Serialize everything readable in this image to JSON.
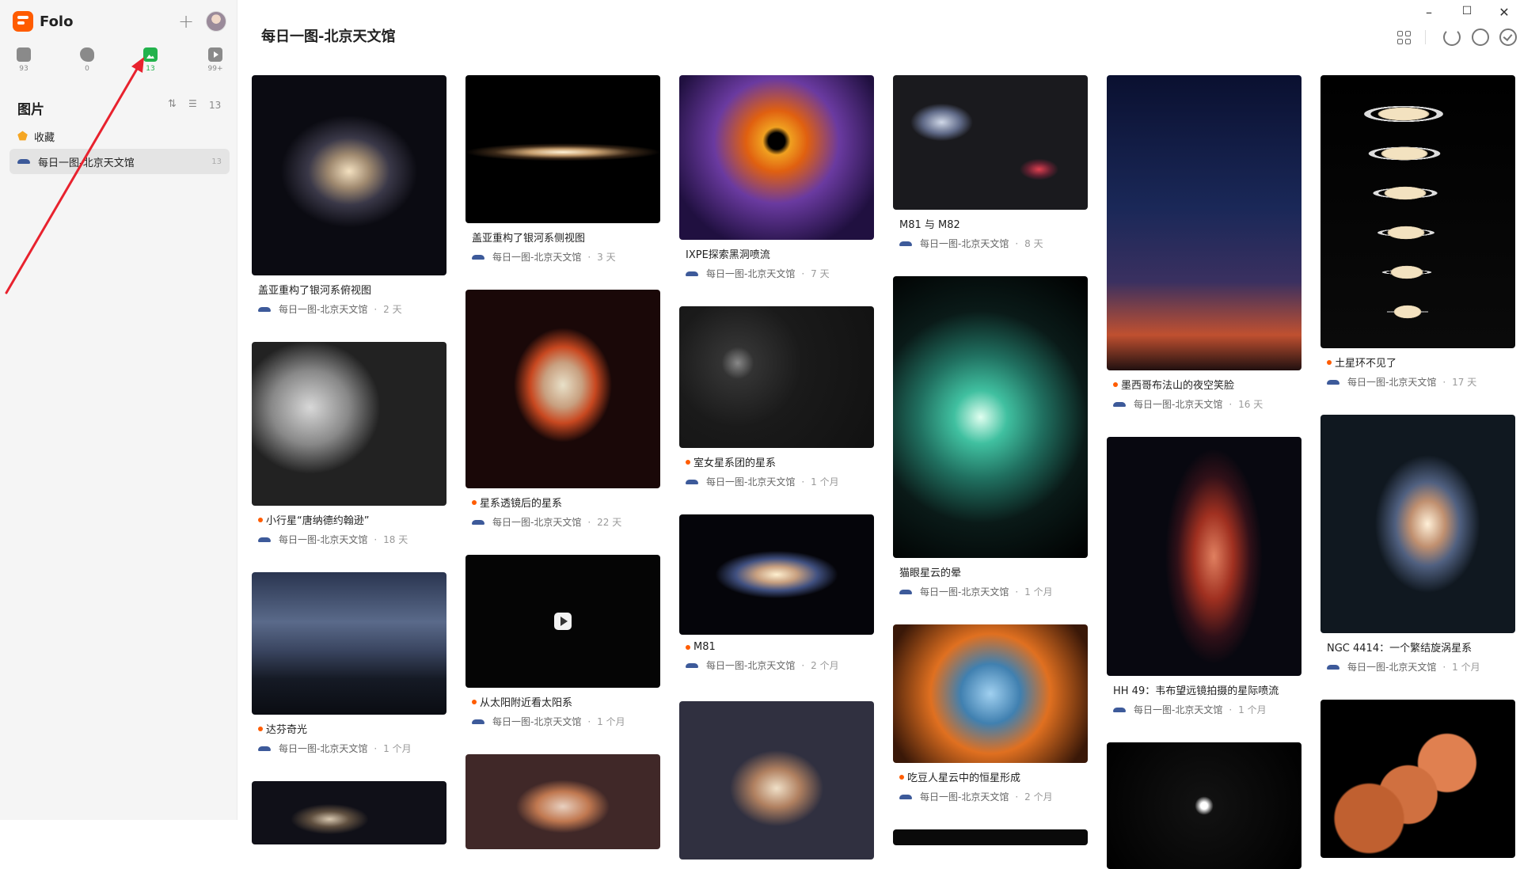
{
  "app": {
    "name": "Folo"
  },
  "sidebar": {
    "views": [
      {
        "icon": "article-icon",
        "count": "93"
      },
      {
        "icon": "twitter-icon",
        "count": "0"
      },
      {
        "icon": "picture-icon",
        "count": "13",
        "active": true
      },
      {
        "icon": "video-icon",
        "count": "99+"
      }
    ],
    "section_title": "图片",
    "section_count": "13",
    "favorites_label": "收藏",
    "feed": {
      "label": "每日一图-北京天文馆",
      "count": "13"
    }
  },
  "main": {
    "title": "每日一图-北京天文馆",
    "source": "每日一图-北京天文馆",
    "cards": [
      {
        "title": "盖亚重构了银河系俯视图",
        "ago": "2 天",
        "unread": false,
        "bg": "radial-gradient(ellipse 35% 28% at 50% 48%,#f3e0c0 0,#a08a70 30%,#3a3848 60%,#0b0b12 100%)"
      },
      {
        "title": "小行星“唐纳德约翰逊”",
        "ago": "18 天",
        "unread": true,
        "bg": "radial-gradient(ellipse 40% 45% at 30% 40%,#d8d8d8,#888 50%,#222 90%),radial-gradient(ellipse 30% 40% at 78% 55%,#c8c8c8,#777 55%,#111 95%)"
      },
      {
        "title": "达芬奇光",
        "ago": "1 个月",
        "unread": true,
        "bg": "linear-gradient(180deg,#2a3550 0%,#5a6a8a 35%,#3a4560 55%,#151a25 75%,#0a0c12 100%)"
      },
      {
        "title": "",
        "ago": "",
        "unread": false,
        "bg": "radial-gradient(ellipse 25% 30% at 40% 60%,#d8c8b0 0,#605040 40%,#101018 80%)"
      },
      {
        "title": "盖亚重构了银河系侧视图",
        "ago": "3 天",
        "unread": false,
        "bg": "radial-gradient(ellipse 50% 6% at 50% 52%,#fff3d8 0,#c8a070 35%,#3a2818 70%,#000 100%)"
      },
      {
        "title": "星系透镜后的星系",
        "ago": "22 天",
        "unread": true,
        "bg": "radial-gradient(ellipse 28% 32% at 50% 48%,#e8e0c8 0,#c8a080 35%,#c84820 60%,#1a0808 90%)"
      },
      {
        "title": "从太阳附近看太阳系",
        "ago": "1 个月",
        "unread": true,
        "bg": "#050505",
        "video": true
      },
      {
        "title": "",
        "ago": "",
        "unread": false,
        "bg": "radial-gradient(ellipse 30% 35% at 50% 55%,#e8d0c0 0,#c07850 45%,#402828 80%)"
      },
      {
        "title": "IXPE探索黑洞喷流",
        "ago": "7 天",
        "unread": false,
        "bg": "radial-gradient(circle at 50% 40%,#000 0 6%,#f0a020 10%,#e06010 22%,#6a3aa0 45%,#201040 80%)"
      },
      {
        "title": "室女星系团的星系",
        "ago": "1 个月",
        "unread": true,
        "bg": "radial-gradient(circle at 30% 40%,#888 0,#333 10%,#1a1a1a 40%,#111 100%)"
      },
      {
        "title": "M81",
        "ago": "2 个月",
        "unread": true,
        "bg": "radial-gradient(ellipse 35% 22% at 50% 50%,#fff0d0 0,#c8a080 30%,#405080 60%,#05050a 90%)"
      },
      {
        "title": "",
        "ago": "",
        "unread": false,
        "bg": "radial-gradient(ellipse 30% 30% at 50% 55%,#f0e0c8 0,#b08060 40%,#303040 80%)"
      },
      {
        "title": "M81 与 M82",
        "ago": "8 天",
        "unread": false,
        "bg": "radial-gradient(ellipse 16% 14% at 25% 35%,#d0d8e8 0,#606a88 60%,transparent 100%),radial-gradient(ellipse 10% 8% at 75% 70%,#e04050 0,#602030 60%,transparent 100%),#1a1a1e"
      },
      {
        "title": "猫眼星云的晕",
        "ago": "1 个月",
        "unread": false,
        "bg": "radial-gradient(circle at 45% 50%,#e0fff0 0,#40c0a0 15%,#207060 35%,#0a1a18 60%,#000 100%)"
      },
      {
        "title": "吃豆人星云中的恒星形成",
        "ago": "2 个月",
        "unread": true,
        "bg": "radial-gradient(circle at 50% 50%,#a0d0f0 0,#4080b0 25%,#e07020 50%,#3a1808 90%)"
      },
      {
        "title": "",
        "ago": "",
        "unread": false,
        "bg": "#0a0a0a"
      },
      {
        "title": "墨西哥布法山的夜空笑脸",
        "ago": "16 天",
        "unread": true,
        "bg": "linear-gradient(180deg,#0a1030 0%,#1a2858 45%,#3a3060 70%,#c05030 88%,#201010 100%)"
      },
      {
        "title": "HH 49：韦布望远镜拍摄的星际喷流",
        "ago": "1 个月",
        "unread": false,
        "bg": "radial-gradient(ellipse 25% 45% at 55% 50%,#e08060 0,#a03020 40%,#301018 75%,#080810 100%)"
      },
      {
        "title": "",
        "ago": "",
        "unread": false,
        "bg": "radial-gradient(circle at 50% 50%,#fff 0 3%,#111 8%,#000 100%)"
      },
      {
        "title": "土星环不见了",
        "ago": "17 天",
        "unread": true,
        "bg": "linear-gradient(180deg,#000 0%,#0a0a0a 100%)",
        "saturn": true
      },
      {
        "title": "NGC 4414：一个繁结旋涡星系",
        "ago": "1 个月",
        "unread": false,
        "bg": "radial-gradient(ellipse 30% 35% at 55% 50%,#fff0d8 0,#c09070 30%,#506080 55%,#101820 90%)"
      },
      {
        "title": "",
        "ago": "",
        "unread": false,
        "bg": "radial-gradient(circle at 25% 75%,#c06030 0 18%,transparent 19%),radial-gradient(circle at 45% 60%,#d07040 0 20%,transparent 21%),radial-gradient(circle at 65% 40%,#e08050 0 18%,transparent 19%),#000"
      }
    ]
  }
}
